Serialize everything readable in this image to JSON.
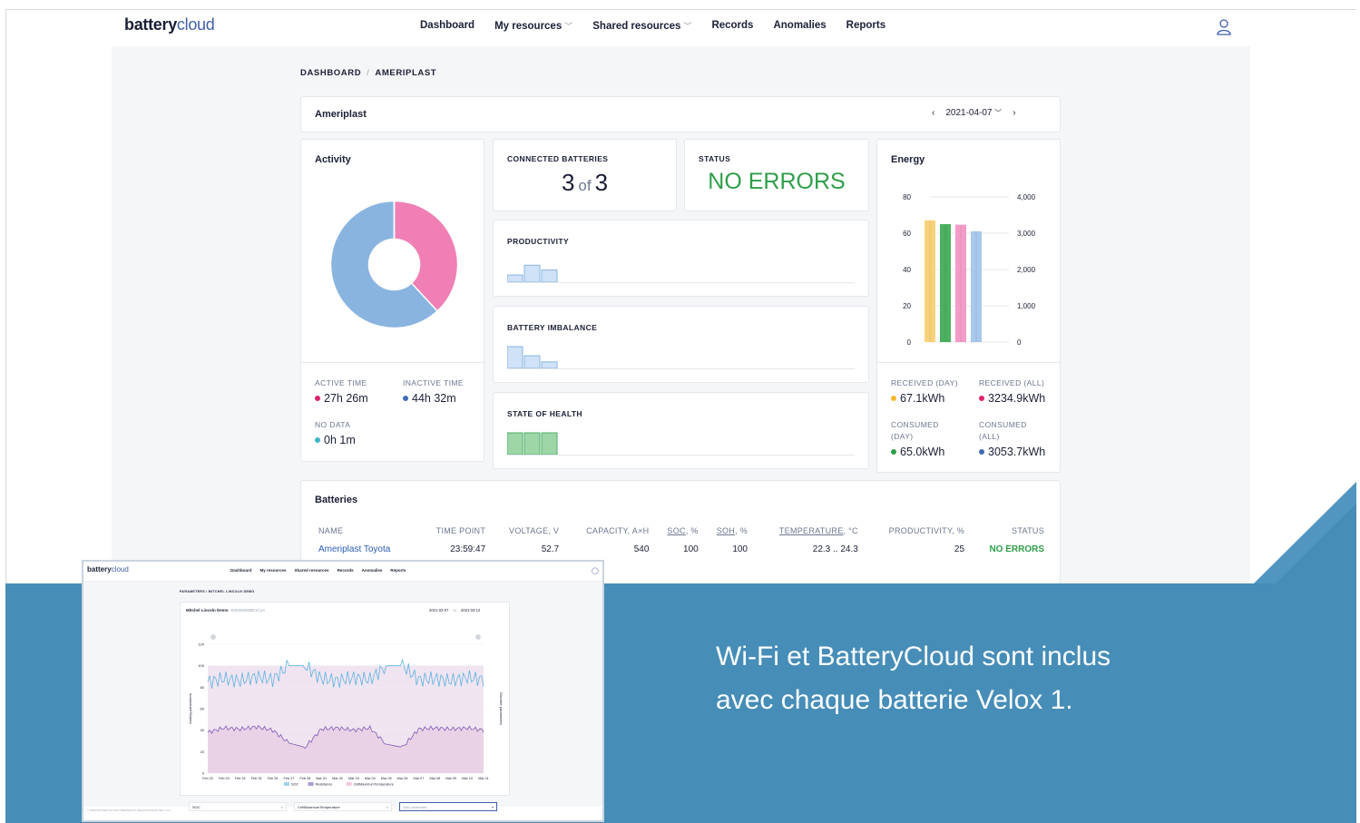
{
  "app": {
    "logo_bold": "battery",
    "logo_light": "cloud"
  },
  "nav": {
    "links": [
      {
        "label": "Dashboard",
        "dropdown": false
      },
      {
        "label": "My resources",
        "dropdown": true
      },
      {
        "label": "Shared resources",
        "dropdown": true
      },
      {
        "label": "Records",
        "dropdown": false
      },
      {
        "label": "Anomalies",
        "dropdown": false
      },
      {
        "label": "Reports",
        "dropdown": false
      }
    ],
    "user_icon": "user-icon"
  },
  "breadcrumb": {
    "root": "DASHBOARD",
    "current": "AMERIPLAST"
  },
  "header": {
    "title": "Ameriplast",
    "date": "2021-04-07",
    "prev_icon": "chevron-left-icon",
    "next_icon": "chevron-right-icon"
  },
  "activity": {
    "title": "Activity",
    "chart_data": {
      "type": "pie",
      "categories": [
        "Active time",
        "Inactive time",
        "No data"
      ],
      "values": [
        1646,
        2672,
        1
      ],
      "colors": [
        "#f07fb5",
        "#8ab4e0",
        "#3fb6c8"
      ]
    },
    "active_label": "ACTIVE TIME",
    "active_value": "27h 26m",
    "inactive_label": "INACTIVE TIME",
    "inactive_value": "44h 32m",
    "nodata_label": "NO DATA",
    "nodata_value": "0h 1m",
    "colors": {
      "active": "#e0226e",
      "inactive": "#3f6db5",
      "nodata": "#3fb6c8"
    }
  },
  "connected": {
    "label": "CONNECTED BATTERIES",
    "count": "3",
    "of": "of",
    "total": "3"
  },
  "status": {
    "label": "STATUS",
    "value": "NO ERRORS",
    "color": "#2e9e48"
  },
  "productivity": {
    "label": "PRODUCTIVITY",
    "bars": [
      0.33,
      0.78,
      0.56
    ],
    "fill": "#cfe2f7",
    "stroke": "#8ab4e0"
  },
  "imbalance": {
    "label": "BATTERY IMBALANCE",
    "bars": [
      1.0,
      0.58,
      0.3
    ],
    "fill": "#cfe2f7",
    "stroke": "#8ab4e0"
  },
  "health": {
    "label": "STATE OF HEALTH",
    "bars": [
      1.0,
      1.0,
      1.0
    ],
    "fill": "#9fd6a8",
    "stroke": "#4caf6a"
  },
  "energy": {
    "title": "Energy",
    "chart_data": {
      "type": "bar",
      "categories": [
        "Received (day)",
        "Consumed (day)",
        "Received (all)",
        "Consumed (all)"
      ],
      "values": [
        67.1,
        65.0,
        3234.9,
        3053.7
      ],
      "axis": [
        "left",
        "left",
        "right",
        "right"
      ],
      "colors": [
        "#f8d27a",
        "#4bb060",
        "#f49bc8",
        "#a8c8ec"
      ],
      "ylim_left": [
        0,
        80
      ],
      "yticks_left": [
        "0",
        "20",
        "40",
        "60",
        "80"
      ],
      "ylim_right": [
        0,
        4000
      ],
      "yticks_right": [
        "0",
        "1,000",
        "2,000",
        "3,000",
        "4,000"
      ]
    },
    "rday_label": "RECEIVED (DAY)",
    "rday_value": "67.1kWh",
    "rall_label": "RECEIVED (ALL)",
    "rall_value": "3234.9kWh",
    "cday_label1": "CONSUMED",
    "cday_label2": "(DAY)",
    "cday_value": "65.0kWh",
    "call_label1": "CONSUMED",
    "call_label2": "(ALL)",
    "call_value": "3053.7kWh",
    "colors": {
      "rday": "#f5b72a",
      "rall": "#e0226e",
      "cday": "#2e9e48",
      "call": "#3f6db5"
    }
  },
  "batteries": {
    "title": "Batteries",
    "columns": [
      "NAME",
      "TIME POINT",
      "VOLTAGE, V",
      "CAPACITY, A×H",
      "SOC",
      ", %",
      "SOH",
      ", %",
      "TEMPERATURE",
      ", °C",
      "PRODUCTIVITY, %",
      "STATUS"
    ],
    "rows": [
      {
        "name": "Ameriplast Toyota",
        "time": "23:59:47",
        "voltage": "52.7",
        "capacity": "540",
        "soc": "100",
        "soh": "100",
        "temp": "22.3 .. 24.3",
        "productivity": "25",
        "status": "NO ERRORS"
      }
    ]
  },
  "tagline": {
    "line1": "Wi-Fi et BatteryCloud sont inclus",
    "line2": "avec chaque batterie Velox 1."
  },
  "colors": {
    "band": "#468db8",
    "band_light": "#5aa0c8"
  },
  "inset": {
    "nav_links": [
      "Dashboard",
      "My resources",
      "Shared resources",
      "Records",
      "Anomalies",
      "Reports"
    ],
    "breadcrumb": "PARAMETERS / MITCHEL LINCOLN DEMO",
    "title": "Mitchel Lincoln Demo",
    "subtitle": "E0030000BE1C1A",
    "date_from": "2021-02-07",
    "date_to_label": "to",
    "date_to": "2021-03-12",
    "y_left_label": "Analog parameters",
    "y_right_label": "Discrete parameters",
    "chart_data": {
      "type": "line",
      "x": [
        "Feb 22",
        "Feb 23",
        "Feb 24",
        "Feb 25",
        "Feb 26",
        "Feb 27",
        "Feb 28",
        "Mar 01",
        "Mar 02",
        "Mar 03",
        "Mar 04",
        "Mar 05",
        "Mar 06",
        "Mar 07",
        "Mar 08",
        "Mar 09",
        "Mar 10",
        "Mar 11"
      ],
      "ylim": [
        0,
        120
      ],
      "yticks": [
        "0",
        "20",
        "40",
        "60",
        "80",
        "100",
        "120"
      ],
      "series": [
        {
          "name": "SOC",
          "color": "#5ab4df",
          "values": [
            85,
            88,
            86,
            90,
            87,
            100,
            100,
            88,
            86,
            89,
            87,
            100,
            100,
            87,
            88,
            86,
            89,
            87
          ]
        },
        {
          "name": "Resistance",
          "color": "#7c5ab8",
          "values": [
            38,
            42,
            41,
            43,
            40,
            28,
            24,
            41,
            42,
            40,
            42,
            27,
            24,
            41,
            42,
            41,
            42,
            40
          ]
        },
        {
          "name": "CellMaximumTemperature",
          "color": "#e6a6c9",
          "values": []
        }
      ]
    },
    "params": [
      "SOC",
      "CellMaximumTemperature"
    ],
    "add_placeholder": "Add parameter...",
    "footer": "© 2020 BATTERYCLOUD CREATED BY WEHICON ELECTRIC LLC"
  }
}
